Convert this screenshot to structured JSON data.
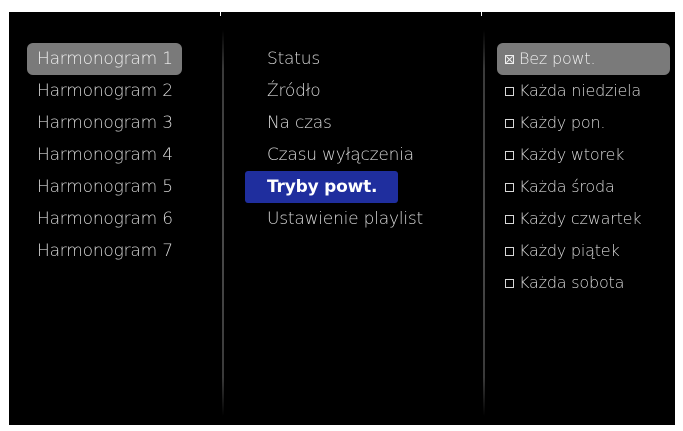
{
  "schedules": {
    "items": [
      {
        "label": "Harmonogram 1",
        "selected": true
      },
      {
        "label": "Harmonogram 2",
        "selected": false
      },
      {
        "label": "Harmonogram 3",
        "selected": false
      },
      {
        "label": "Harmonogram 4",
        "selected": false
      },
      {
        "label": "Harmonogram 5",
        "selected": false
      },
      {
        "label": "Harmonogram 6",
        "selected": false
      },
      {
        "label": "Harmonogram 7",
        "selected": false
      }
    ]
  },
  "settings": {
    "items": [
      {
        "label": "Status",
        "selected": false
      },
      {
        "label": "Źródło",
        "selected": false
      },
      {
        "label": "Na czas",
        "selected": false
      },
      {
        "label": "Czasu wyłączenia",
        "selected": false
      },
      {
        "label": "Tryby powt.",
        "selected": true
      },
      {
        "label": "Ustawienie playlist",
        "selected": false
      }
    ]
  },
  "repeat_modes": {
    "items": [
      {
        "label": "Bez powt.",
        "checked": true,
        "selected": true
      },
      {
        "label": "Każda niedziela",
        "checked": false,
        "selected": false
      },
      {
        "label": "Każdy pon.",
        "checked": false,
        "selected": false
      },
      {
        "label": "Każdy wtorek",
        "checked": false,
        "selected": false
      },
      {
        "label": "Każda środa",
        "checked": false,
        "selected": false
      },
      {
        "label": "Każdy czwartek",
        "checked": false,
        "selected": false
      },
      {
        "label": "Każdy piątek",
        "checked": false,
        "selected": false
      },
      {
        "label": "Każda sobota",
        "checked": false,
        "selected": false
      }
    ]
  },
  "colors": {
    "background": "#000000",
    "text": "#d8d8d8",
    "selected_grey": "#7a7a7a",
    "selected_blue": "#1f2e9e"
  }
}
